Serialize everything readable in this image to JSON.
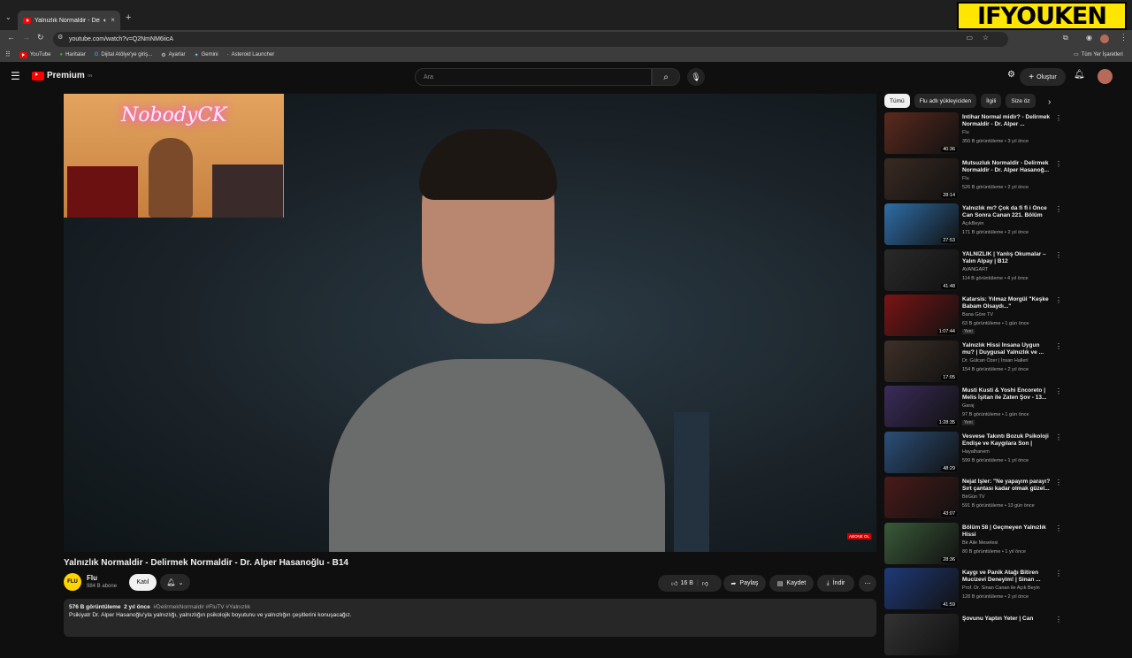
{
  "browser": {
    "tab_title": "Yalnızlık Normaldir - Delirm",
    "url": "youtube.com/watch?v=Q2NmNM6iicA",
    "bookmarks": [
      "YouTube",
      "Haritalar",
      "Dijital Atölye'ye giriş...",
      "Ayarlar",
      "Gemini",
      "Asteroid Launcher"
    ],
    "all_bookmarks": "Tüm Yer İşaretleri"
  },
  "watermark": "IFYOUKEN",
  "header": {
    "logo": "Premium",
    "logo_sup": "TR",
    "search_placeholder": "Ara",
    "create_label": "Oluştur"
  },
  "video": {
    "overlay_neon": "NobodyCK",
    "abone_badge": "ABONE OL",
    "title": "Yalnızlık Normaldir - Delirmek Normaldir - Dr. Alper Hasanoğlu - B14",
    "channel_name": "Flu",
    "channel_avatar": "FLU",
    "subscribers": "984 B abone",
    "join_label": "Katıl",
    "likes": "16 B",
    "share_label": "Paylaş",
    "save_label": "Kaydet",
    "download_label": "İndir",
    "views": "576 B görüntüleme",
    "age": "2 yıl önce",
    "hashtags": "#DelirmekNormaldir #FluTV #Yalnızlık",
    "description": "Psikiyatr Dr. Alper Hasanoğlu'yla yalnızlığı, yalnızlığın psikolojik boyutunu ve yalnızlığın çeşitlerini konuşacağız."
  },
  "sidebar": {
    "chips": [
      "Tümü",
      "Flu adlı yükleyiciden",
      "İlgili",
      "Size öz"
    ],
    "recommendations": [
      {
        "title": "İntihar Normal midir? - Delirmek Normaldir - Dr. Alper ...",
        "channel": "Flu",
        "meta": "350 B görüntüleme • 3 yıl önce",
        "duration": "40:36",
        "color": "#5b2a1e"
      },
      {
        "title": "Mutsuzluk Normaldir - Delirmek Normaldir - Dr. Alper Hasanoğ...",
        "channel": "Flu",
        "meta": "526 B görüntüleme • 2 yıl önce",
        "duration": "28:14",
        "color": "#3a2a22"
      },
      {
        "title": "Yalnızlık mı? Çok da fi fi i Önce Can Sonra Canan 221. Bölüm",
        "channel": "AçıkBeyin",
        "meta": "171 B görüntüleme • 2 yıl önce",
        "duration": "27:53",
        "color": "#2f6ea8"
      },
      {
        "title": "YALNIZLIK | Yanlış Okumalar – Yalın Alpay | B12",
        "channel": "AVANGART",
        "meta": "114 B görüntüleme • 4 yıl önce",
        "duration": "41:48",
        "color": "#2a2a2a"
      },
      {
        "title": "Katarsis: Yılmaz Morgül \"Keşke Babam Olsaydı...\"",
        "channel": "Bana Göre TV",
        "meta": "63 B görüntüleme • 1 gün önce",
        "duration": "1:07:44",
        "color": "#7a1414",
        "new": "Yeni"
      },
      {
        "title": "Yalnızlık Hissi İnsana Uygun mu? | Duygusal Yalnızlık ve ...",
        "channel": "Dr. Gülcan Özer | İnsan Halleri",
        "meta": "154 B görüntüleme • 2 yıl önce",
        "duration": "17:05",
        "color": "#3e3028"
      },
      {
        "title": "Musti Kusti & Yoshi Encoreto | Melis İşitan ile Zaten Şov - 13...",
        "channel": "Garaj",
        "meta": "97 B görüntüleme • 1 gün önce",
        "duration": "1:28:35",
        "color": "#3a2c5a",
        "new": "Yeni"
      },
      {
        "title": "Vesvese Takıntı Bozuk Psikoloji Endişe ve Kaygılara Son | Prof....",
        "channel": "Hayalhanem",
        "meta": "599 B görüntüleme • 1 yıl önce",
        "duration": "48:29",
        "color": "#2b4f7a"
      },
      {
        "title": "Nejat İşler: \"Ne yapayım parayı? Sırt çantası kadar olmak güzel...",
        "channel": "BirGün TV",
        "meta": "591 B görüntüleme • 13 gün önce",
        "duration": "43:07",
        "color": "#4a1a1a"
      },
      {
        "title": "Bölüm 58 | Geçmeyen Yalnızlık Hissi",
        "channel": "Bir Aile Meselesi",
        "meta": "80 B görüntüleme • 1 yıl önce",
        "duration": "28:36",
        "color": "#3a5a3a"
      },
      {
        "title": "Kaygı ve Panik Atağı Bitiren Mucizevi Deneyim! | Sinan ...",
        "channel": "Prof. Dr. Sinan Canan ile Açık Beyin",
        "meta": "128 B görüntüleme • 2 yıl önce",
        "duration": "41:59",
        "color": "#1f3a7a"
      },
      {
        "title": "Şovunu Yaptın Yeter | Can",
        "channel": "",
        "meta": "",
        "duration": "",
        "color": "#333"
      }
    ]
  }
}
